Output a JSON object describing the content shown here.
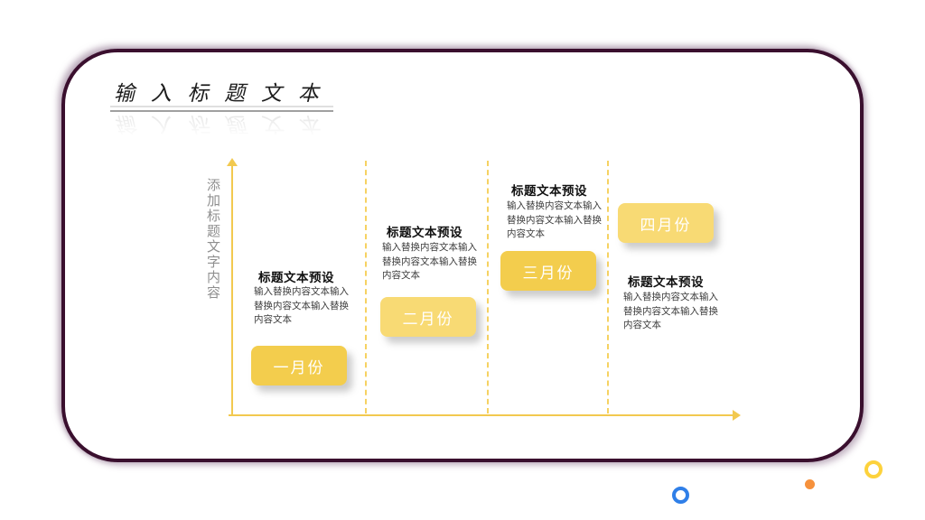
{
  "slide": {
    "title": "输 入 标 题 文 本",
    "vertical_axis_label": "添加标题文字内容",
    "columns": [
      {
        "heading": "标题文本预设",
        "body": "输入替换内容文本输入替换内容文本输入替换内容文本",
        "month_label": "一月份",
        "tone": "deep"
      },
      {
        "heading": "标题文本预设",
        "body": "输入替换内容文本输入替换内容文本输入替换内容文本",
        "month_label": "二月份",
        "tone": "light"
      },
      {
        "heading": "标题文本预设",
        "body": "输入替换内容文本输入替换内容文本输入替换内容文本",
        "month_label": "三月份",
        "tone": "deep"
      },
      {
        "heading": "标题文本预设",
        "body": "输入替换内容文本输入替换内容文本输入替换内容文本",
        "month_label": "四月份",
        "tone": "light"
      }
    ]
  },
  "colors": {
    "frame_border": "#3a0f2e",
    "axis_yellow": "#f2c94f",
    "dashed_line": "#f6d262",
    "button_deep": "#f3cd4d",
    "button_light": "#f8da74",
    "button_text": "#ffffff",
    "ring_yellow": "#fdd23c",
    "dot_orange": "#f6913c",
    "ring_blue": "#2f7fe8"
  }
}
